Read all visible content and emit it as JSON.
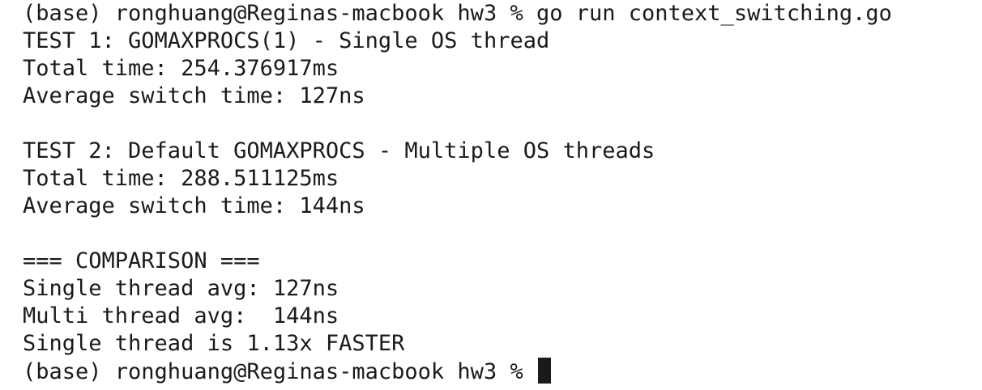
{
  "terminal": {
    "prompt": "(base) ronghuang@Reginas-macbook hw3 %",
    "command": "go run context_switching.go",
    "test1": {
      "header": "TEST 1: GOMAXPROCS(1) - Single OS thread",
      "total_time": "Total time: 254.376917ms",
      "avg_switch": "Average switch time: 127ns"
    },
    "test2": {
      "header": "TEST 2: Default GOMAXPROCS - Multiple OS threads",
      "total_time": "Total time: 288.511125ms",
      "avg_switch": "Average switch time: 144ns"
    },
    "comparison": {
      "header": "=== COMPARISON ===",
      "single_avg": "Single thread avg: 127ns",
      "multi_avg": "Multi thread avg:  144ns",
      "result": "Single thread is 1.13x FASTER"
    },
    "final_prompt": "(base) ronghuang@Reginas-macbook hw3 %"
  },
  "colors": {
    "background": "#ffffff",
    "text": "#1a1a1a",
    "cursor": "#1a1a1a"
  }
}
